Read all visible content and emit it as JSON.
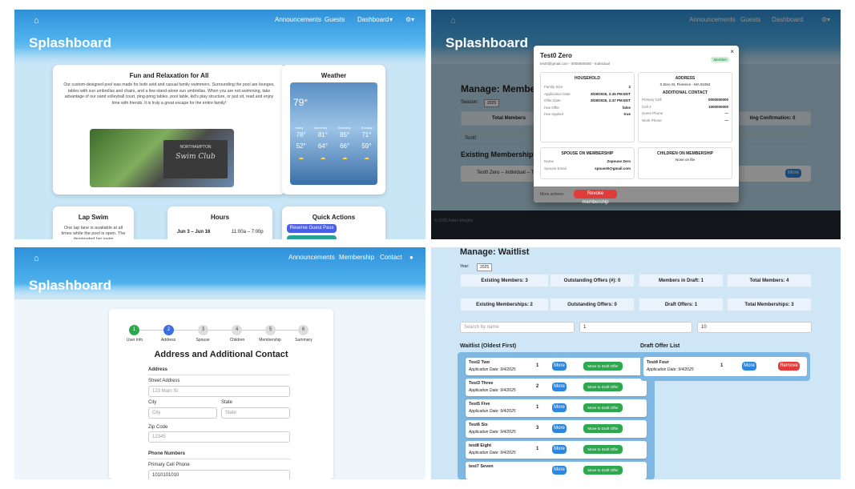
{
  "q1": {
    "brand": "Splashboard",
    "nav": [
      "Announcements",
      "Guests",
      "Dashboard"
    ],
    "fun": {
      "title": "Fun and Relaxation for All",
      "body": "Our custom-designed pool was made for both avid and casual family swimmers. Surrounding the pool are lounges, tables with sun umbrellas and chairs, and a few stand-alone sun umbrellas. When you are not swimming, take advantage of our sand volleyball court, ping-pong tables, pool table, kid's play structure, or just sit, read and enjoy time with friends. It is truly a great escape for the entire family!",
      "sign1": "NORTHAMPTON",
      "sign2": "Swim Club"
    },
    "weather": {
      "title": "Weather",
      "now": "79°",
      "days": [
        "today",
        "tomorrow",
        "Saturday",
        "Sunday"
      ],
      "hi": [
        "78°",
        "81°",
        "85°",
        "71°"
      ],
      "lo": [
        "52°",
        "64°",
        "66°",
        "59°"
      ]
    },
    "lap": {
      "title": "Lap Swim",
      "text": "One lap lane is available at all times while the pool is open. The designated lap swim"
    },
    "hours": {
      "title": "Hours",
      "range": "Jun 3 – Jun 16",
      "time": "11:00a – 7:00p"
    },
    "quick": {
      "title": "Quick Actions",
      "reserve": "Reserve Guest Pass"
    }
  },
  "q2": {
    "brand": "Splashboard",
    "nav": [
      "Announcements",
      "Guests",
      "Dashboard"
    ],
    "bg_title": "Manage: Member",
    "season": "Season:",
    "year": "2025",
    "total_members": "Total Members",
    "pending": "ting Confirmation: 0",
    "search": "Test0",
    "existing": "Existing Memberships",
    "rowtext": "Test0 Zero -- individual -- T",
    "more": "More",
    "footer": "© 2025 Aiden Murphy",
    "modal": {
      "name": "Test0 Zero",
      "sub": "test0@gmail.com - 0000000000 - Individual",
      "badge": "Member",
      "household": "HOUSEHOLD",
      "hh": [
        [
          "Family Size",
          "2"
        ],
        [
          "Application Date",
          "8/28/2025, 2:45 PM EDT"
        ],
        [
          "Offer Date",
          "8/28/2025, 2:47 PM EDT"
        ],
        [
          "Has Offer",
          "false"
        ],
        [
          "Has Applied",
          "true"
        ]
      ],
      "address_h": "ADDRESS",
      "address": "0 Zero St, Florence - MA 01062",
      "contact_h": "ADDITIONAL CONTACT",
      "contacts": [
        [
          "Primary Cell",
          "0000000000"
        ],
        [
          "Cell 2",
          "1000000000"
        ],
        [
          "Home Phone",
          "—"
        ],
        [
          "Work Phone",
          "—"
        ]
      ],
      "spouse_h": "SPOUSE ON MEMBERSHIP",
      "spouse": [
        [
          "Name",
          "Zspouse Zero"
        ],
        [
          "Spouse Email",
          "spouse0@gmail.com"
        ]
      ],
      "children_h": "CHILDREN ON MEMBERSHIP",
      "children": "None on file",
      "actions": "More actions:",
      "revoke": "Revoke membership",
      "close": "×"
    }
  },
  "q3": {
    "brand": "Splashboard",
    "nav": [
      "Announcements",
      "Membership",
      "Contact"
    ],
    "steps": [
      {
        "n": "1",
        "l": "User Info"
      },
      {
        "n": "2",
        "l": "Address"
      },
      {
        "n": "3",
        "l": "Spouse"
      },
      {
        "n": "4",
        "l": "Children"
      },
      {
        "n": "5",
        "l": "Membership"
      },
      {
        "n": "6",
        "l": "Summary"
      }
    ],
    "title": "Address and Additional Contact",
    "address": "Address",
    "street": "Street Address",
    "street_ph": "123 Main St",
    "city": "City",
    "city_ph": "City",
    "state": "State",
    "state_ph": "State",
    "zip": "Zip Code",
    "zip_ph": "12345",
    "phones": "Phone Numbers",
    "primary": "Primary Cell Phone",
    "primary_val": "1010101010"
  },
  "q4": {
    "title": "Manage: Waitlist",
    "year_label": "Year:",
    "year": "2025",
    "stats1": [
      "Existing Members: 3",
      "Outstanding Offers (#): 0",
      "Members in Draft: 1",
      "Total Members: 4"
    ],
    "stats2": [
      "Existing Memberships: 2",
      "Outstanding Offers: 0",
      "Draft Offers: 1",
      "Total Memberships: 3"
    ],
    "search_ph": "Search by name",
    "f1": "1",
    "f2": "10",
    "wl_title": "Waitlist (Oldest First)",
    "draft_title": "Draft Offer List",
    "rows": [
      {
        "name": "Test2 Two",
        "date": "Application Date: 9/4/2025",
        "n": "1"
      },
      {
        "name": "Test3 Three",
        "date": "Application Date: 9/4/2025",
        "n": "2"
      },
      {
        "name": "Test5 Five",
        "date": "Application Date: 9/4/2025",
        "n": "1"
      },
      {
        "name": "Test6 Six",
        "date": "Application Date: 9/4/2025",
        "n": "3"
      },
      {
        "name": "test8 Eight",
        "date": "Application Date: 9/4/2025",
        "n": "1"
      },
      {
        "name": "test7 Seven",
        "date": "",
        "n": ""
      }
    ],
    "more": "More",
    "move": "Move to Draft Offer",
    "draft": {
      "name": "Test4 Four",
      "date": "Application Date: 9/4/2025",
      "n": "1",
      "remove": "Remove"
    }
  }
}
